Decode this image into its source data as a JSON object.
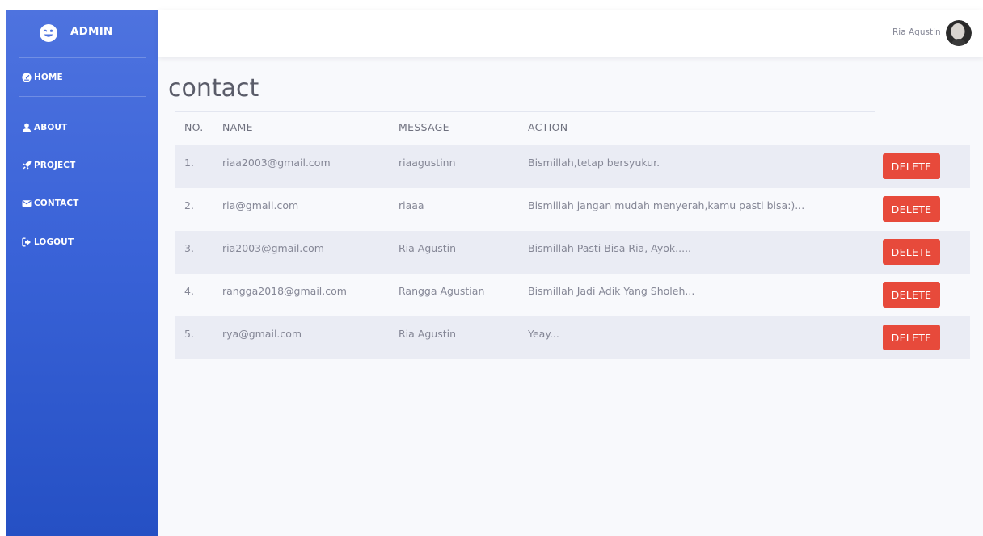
{
  "sidebar": {
    "brand": "ADMIN",
    "items": [
      {
        "label": "HOME",
        "icon": "tachometer-icon"
      },
      {
        "label": "ABOUT",
        "icon": "user-icon"
      },
      {
        "label": "PROJECT",
        "icon": "rocket-icon"
      },
      {
        "label": "CONTACT",
        "icon": "envelope-icon"
      },
      {
        "label": "LOGOUT",
        "icon": "sign-out-icon"
      }
    ]
  },
  "topbar": {
    "user_name": "Ria Agustin"
  },
  "page": {
    "title": "contact"
  },
  "table": {
    "headers": [
      "NO.",
      "NAME",
      "MESSAGE",
      "ACTION"
    ],
    "rows": [
      {
        "no": "1.",
        "name": "riaa2003@gmail.com",
        "message": "riaagustinn",
        "action": "Bismillah,tetap bersyukur.",
        "button": "DELETE"
      },
      {
        "no": "2.",
        "name": "ria@gmail.com",
        "message": "riaaa",
        "action": "Bismillah jangan mudah menyerah,kamu pasti bisa:)...",
        "button": "DELETE"
      },
      {
        "no": "3.",
        "name": "ria2003@gmail.com",
        "message": "Ria Agustin",
        "action": "Bismillah Pasti Bisa Ria, Ayok.....",
        "button": "DELETE"
      },
      {
        "no": "4.",
        "name": "rangga2018@gmail.com",
        "message": "Rangga Agustian",
        "action": "Bismillah Jadi Adik Yang Sholeh...",
        "button": "DELETE"
      },
      {
        "no": "5.",
        "name": "rya@gmail.com",
        "message": "Ria Agustin",
        "action": "Yeay...",
        "button": "DELETE"
      }
    ]
  },
  "colors": {
    "sidebar_top": "#4e73df",
    "sidebar_bottom": "#2550c4",
    "delete_button": "#e74a3b",
    "row_stripe": "#eaecf4",
    "page_bg": "#f8f9fc"
  }
}
